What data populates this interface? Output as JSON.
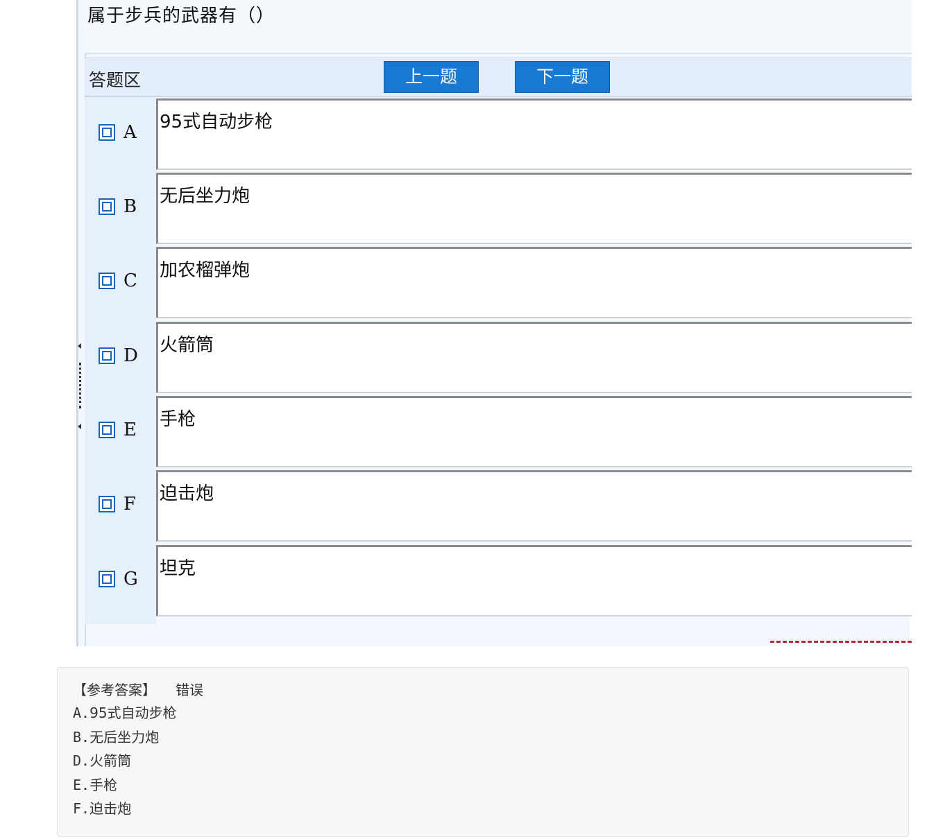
{
  "question": {
    "text": "属于步兵的武器有（）"
  },
  "answer_area": {
    "title": "答题区",
    "prev_label": "上一题",
    "next_label": "下一题"
  },
  "options": [
    {
      "key": "A",
      "text": "95式自动步枪"
    },
    {
      "key": "B",
      "text": "无后坐力炮"
    },
    {
      "key": "C",
      "text": "加农榴弹炮"
    },
    {
      "key": "D",
      "text": "火箭筒"
    },
    {
      "key": "E",
      "text": "手枪"
    },
    {
      "key": "F",
      "text": "迫击炮"
    },
    {
      "key": "G",
      "text": "坦克"
    }
  ],
  "reference": {
    "label": "【参考答案】",
    "verdict": "错误",
    "answers": [
      {
        "key": "A.",
        "text": "95式自动步枪"
      },
      {
        "key": "B.",
        "text": "无后坐力炮"
      },
      {
        "key": "D.",
        "text": "火箭筒"
      },
      {
        "key": "E.",
        "text": "手枪"
      },
      {
        "key": "F.",
        "text": "迫击炮"
      }
    ]
  },
  "colors": {
    "button_bg": "#1779d2",
    "panel_bg": "#f2f8fe",
    "checkbox": "#1166c0",
    "dash_red": "#c0282d"
  }
}
